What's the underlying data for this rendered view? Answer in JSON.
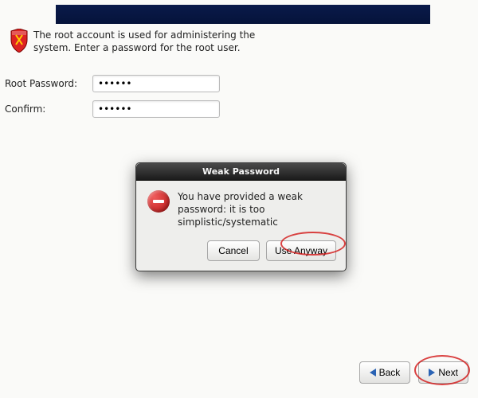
{
  "intro": {
    "text": "The root account is used for administering the system.  Enter a password for the root user."
  },
  "form": {
    "root_label": "Root Password:",
    "confirm_label": "Confirm:",
    "root_value": "••••••",
    "confirm_value": "••••••"
  },
  "dialog": {
    "title": "Weak Password",
    "message": "You have provided a weak password: it is too simplistic/systematic",
    "cancel": "Cancel",
    "use_anyway": "Use Anyway"
  },
  "nav": {
    "back": "Back",
    "next": "Next"
  }
}
